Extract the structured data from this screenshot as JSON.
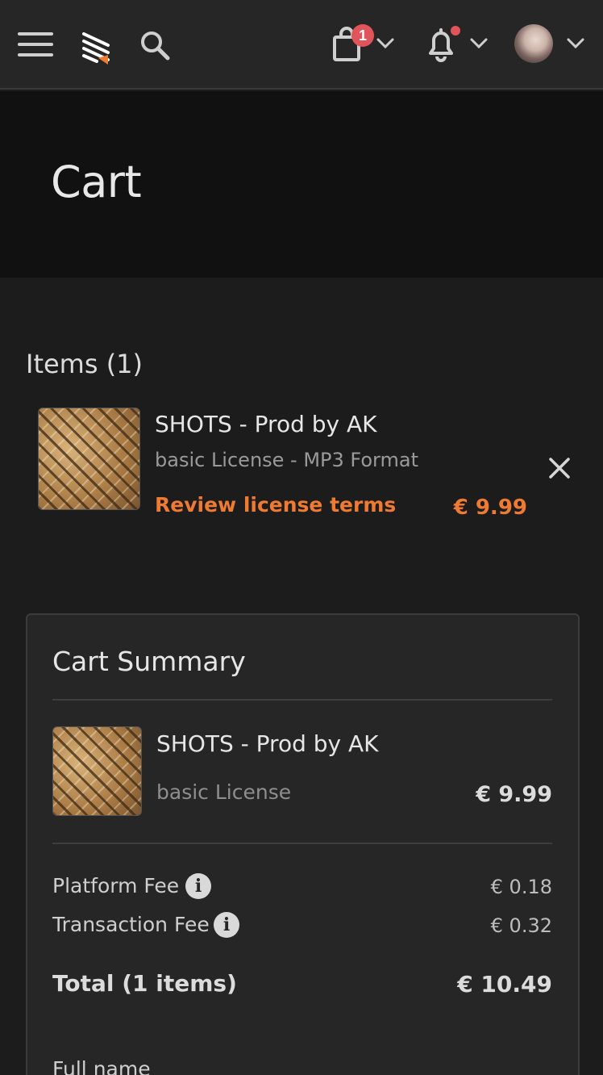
{
  "header": {
    "cart_count": "1",
    "icons": [
      "menu-icon",
      "logo-icon",
      "search-icon",
      "shopping-bag-icon",
      "chevron-down-icon",
      "bell-icon",
      "avatar",
      "close-icon",
      "info-icon"
    ]
  },
  "page": {
    "title": "Cart"
  },
  "items": {
    "heading": "Items (1)",
    "list": [
      {
        "title": "SHOTS - Prod by AK",
        "subtitle": "basic License - MP3 Format",
        "link": "Review license terms",
        "price": "€ 9.99"
      }
    ]
  },
  "summary": {
    "title": "Cart Summary",
    "item": {
      "title": "SHOTS - Prod by AK",
      "license": "basic License",
      "price": "€ 9.99"
    },
    "fees": [
      {
        "label": "Platform Fee",
        "value": "€ 0.18"
      },
      {
        "label": "Transaction Fee",
        "value": "€ 0.32"
      }
    ],
    "info_glyph": "i",
    "total_label": "Total (1 items)",
    "total_value": "€ 10.49",
    "full_name_label": "Full name"
  },
  "colors": {
    "accent": "#ef7a32",
    "badge": "#e0555a",
    "background": "#1c1c1c",
    "header": "#262626"
  }
}
